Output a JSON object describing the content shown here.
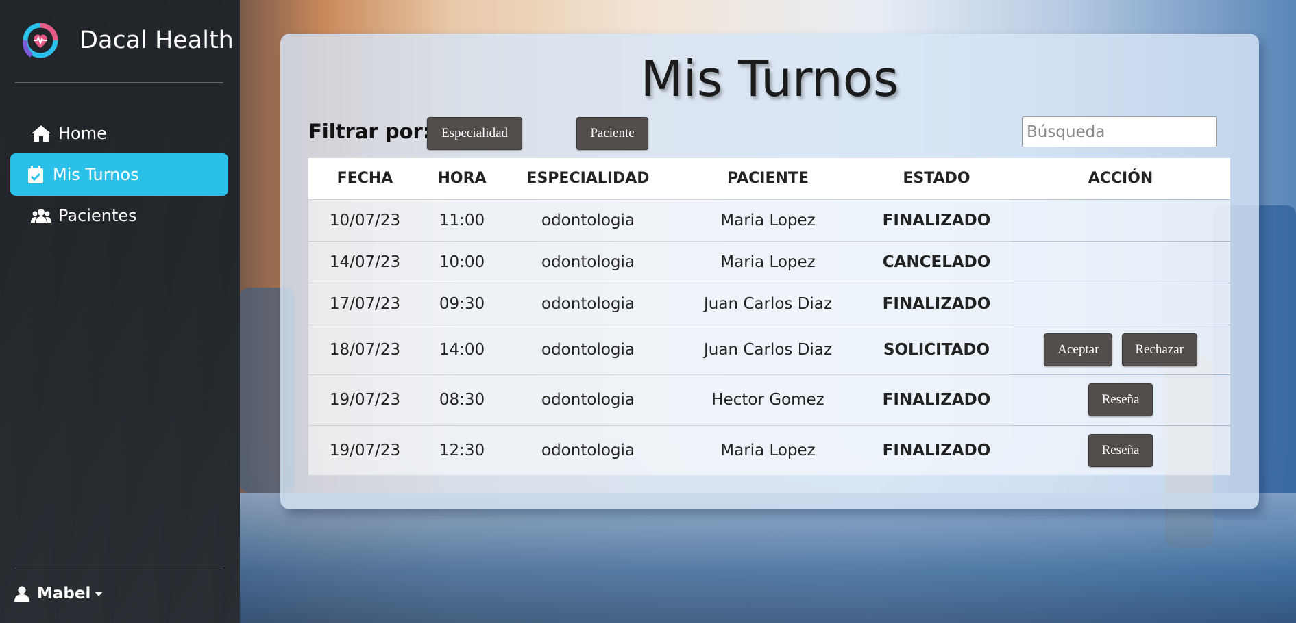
{
  "brand": {
    "name": "Dacal Health",
    "logo_icon": "heartbeat-logo-icon"
  },
  "nav": {
    "items": [
      {
        "label": "Home",
        "icon": "home-icon",
        "active": false
      },
      {
        "label": "Mis Turnos",
        "icon": "calendar-check-icon",
        "active": true
      },
      {
        "label": "Pacientes",
        "icon": "users-icon",
        "active": false
      }
    ]
  },
  "user": {
    "name": "Mabel",
    "icon": "user-icon"
  },
  "page": {
    "title": "Mis Turnos",
    "filter_label": "Filtrar por:",
    "filter_buttons": [
      "Especialidad",
      "Paciente"
    ],
    "search_placeholder": "Búsqueda"
  },
  "table": {
    "headers": [
      "FECHA",
      "HORA",
      "ESPECIALIDAD",
      "PACIENTE",
      "ESTADO",
      "ACCIÓN"
    ],
    "rows": [
      {
        "fecha": "10/07/23",
        "hora": "11:00",
        "especialidad": "odontologia",
        "paciente": "Maria Lopez",
        "estado": "FINALIZADO",
        "acciones": []
      },
      {
        "fecha": "14/07/23",
        "hora": "10:00",
        "especialidad": "odontologia",
        "paciente": "Maria Lopez",
        "estado": "CANCELADO",
        "acciones": []
      },
      {
        "fecha": "17/07/23",
        "hora": "09:30",
        "especialidad": "odontologia",
        "paciente": "Juan Carlos Diaz",
        "estado": "FINALIZADO",
        "acciones": []
      },
      {
        "fecha": "18/07/23",
        "hora": "14:00",
        "especialidad": "odontologia",
        "paciente": "Juan Carlos Diaz",
        "estado": "SOLICITADO",
        "acciones": [
          "Aceptar",
          "Rechazar"
        ]
      },
      {
        "fecha": "19/07/23",
        "hora": "08:30",
        "especialidad": "odontologia",
        "paciente": "Hector Gomez",
        "estado": "FINALIZADO",
        "acciones": [
          "Reseña"
        ]
      },
      {
        "fecha": "19/07/23",
        "hora": "12:30",
        "especialidad": "odontologia",
        "paciente": "Maria Lopez",
        "estado": "FINALIZADO",
        "acciones": [
          "Reseña"
        ]
      }
    ]
  },
  "colors": {
    "accent": "#2bc0ea",
    "sidebar": "#212529",
    "button": "#534d4b"
  }
}
